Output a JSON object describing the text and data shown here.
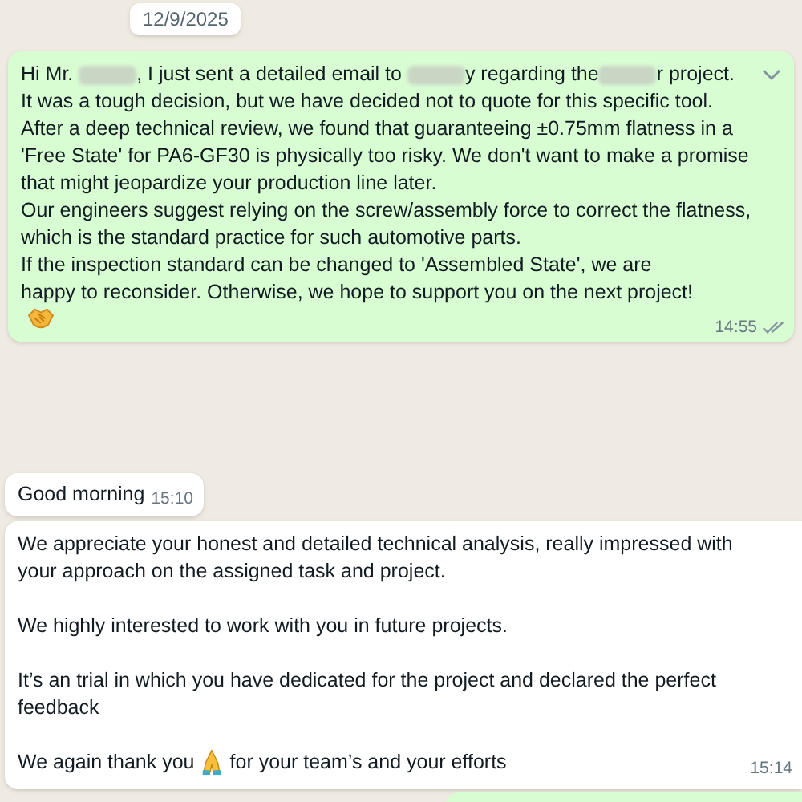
{
  "date_chip": "12/9/2025",
  "messages": [
    {
      "kind": "outgoing",
      "first_line": [
        {
          "kind": "text",
          "text": "Hi Mr. "
        },
        {
          "kind": "redacted"
        },
        {
          "kind": "text",
          "text": ", I just sent a detailed email to "
        },
        {
          "kind": "redacted"
        },
        {
          "kind": "text",
          "text": "y regarding the"
        },
        {
          "kind": "redacted"
        },
        {
          "kind": "text",
          "text": "r project."
        }
      ],
      "paragraphs": [
        "It was a tough decision, but we have decided not to quote for this specific tool.",
        "After a deep technical review, we found that guaranteeing ±0.75mm flatness in a 'Free State' for PA6-GF30 is physically too risky. We don't want to make a promise that might jeopardize your production line later.",
        "Our engineers suggest relying on the screw/assembly force to correct the flatness, which is the standard practice for such automotive parts.",
        "If the inspection standard can be changed to 'Assembled State', we are happy to reconsider. Otherwise, we hope to support you on the next project!"
      ],
      "end_icon": {
        "kind": "handshake"
      },
      "time": "14:55",
      "read": false
    },
    {
      "kind": "incoming",
      "paragraphs": [
        "Good morning"
      ],
      "time": "15:10"
    },
    {
      "kind": "incoming",
      "paragraphs": [
        "We appreciate your honest and detailed technical analysis, really impressed with your approach on the assigned task and project.",
        "We highly interested to work with you in future projects.",
        "It’s an trial in which you have dedicated for the project and declared the perfect feedback"
      ],
      "last_line": [
        {
          "kind": "text",
          "text": "We again thank you"
        },
        {
          "kind": "praying"
        },
        {
          "kind": "text",
          "text": "for your team’s and your efforts"
        }
      ],
      "time": "15:14"
    }
  ]
}
